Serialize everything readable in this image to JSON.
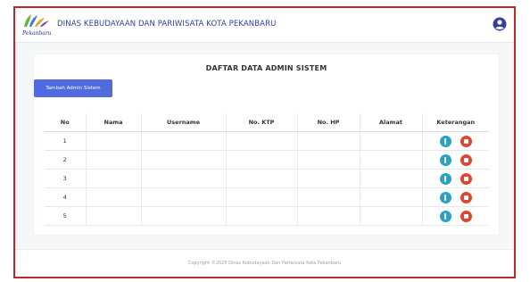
{
  "header": {
    "logo_text": "Pekanbaru",
    "title": "DINAS KEBUDAYAAN DAN PARIWISATA KOTA PEKANBARU"
  },
  "main": {
    "page_title": "DAFTAR DATA ADMIN SISTEM",
    "add_button_label": "Tambah Admin Sistem",
    "table": {
      "columns": [
        "No",
        "Nama",
        "Username",
        "No. KTP",
        "No. HP",
        "Alamat",
        "Keterangan"
      ],
      "rows": [
        {
          "no": "1",
          "nama": "",
          "username": "",
          "ktp": "",
          "hp": "",
          "alamat": ""
        },
        {
          "no": "2",
          "nama": "",
          "username": "",
          "ktp": "",
          "hp": "",
          "alamat": ""
        },
        {
          "no": "3",
          "nama": "",
          "username": "",
          "ktp": "",
          "hp": "",
          "alamat": ""
        },
        {
          "no": "4",
          "nama": "",
          "username": "",
          "ktp": "",
          "hp": "",
          "alamat": ""
        },
        {
          "no": "5",
          "nama": "",
          "username": "",
          "ktp": "",
          "hp": "",
          "alamat": ""
        }
      ]
    }
  },
  "footer": {
    "copyright": "Copyright ©2020 Dinas Kebudayaan Dan Pariwisata Kota Pekanbaru"
  },
  "icons": {
    "user": "user-circle-icon",
    "info": "info-icon",
    "delete": "delete-icon"
  },
  "colors": {
    "frame_border": "#c0262c",
    "primary_button": "#4f6bdd",
    "header_text": "#2f3f9e",
    "info": "#2aa2c3",
    "delete": "#e2452f"
  }
}
